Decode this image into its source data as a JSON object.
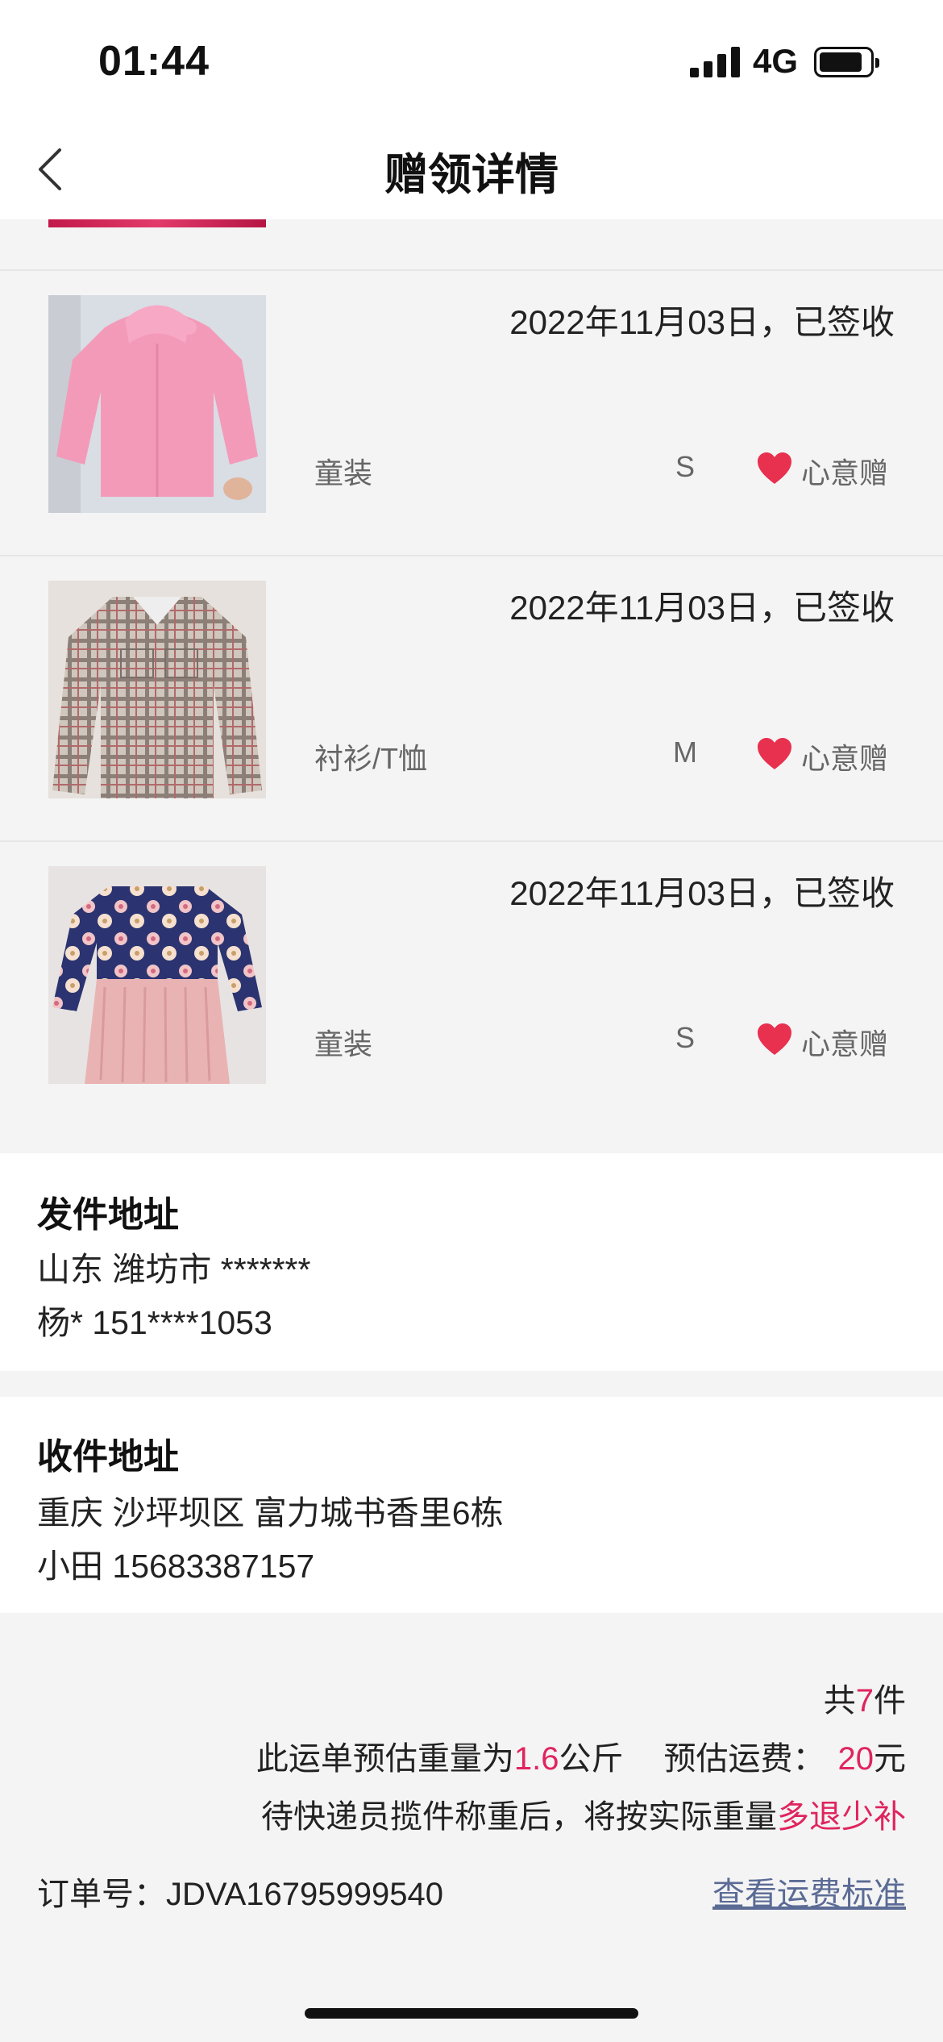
{
  "status_bar": {
    "time": "01:44",
    "network": "4G"
  },
  "nav": {
    "title": "赠领详情"
  },
  "items": [
    {
      "date_status": "2022年11月03日，已签收",
      "category": "童装",
      "size": "S",
      "gift_type": "心意赠",
      "photo": "pink knitted hooded sweater"
    },
    {
      "date_status": "2022年11月03日，已签收",
      "category": "衬衫/T恤",
      "size": "M",
      "gift_type": "心意赠",
      "photo": "plaid shirt dress"
    },
    {
      "date_status": "2022年11月03日，已签收",
      "category": "童装",
      "size": "S",
      "gift_type": "心意赠",
      "photo": "floral top with pink fringe skirt"
    }
  ],
  "sender": {
    "title": "发件地址",
    "address": "山东 潍坊市 *******",
    "contact": "杨* 151****1053"
  },
  "receiver": {
    "title": "收件地址",
    "address": "重庆 沙坪坝区 富力城书香里6栋",
    "contact": "小田 15683387157"
  },
  "summary": {
    "count_prefix": "共",
    "count": "7",
    "count_suffix": "件",
    "weight_prefix": "此运单预估重量为",
    "weight": "1.6",
    "weight_unit": "公斤",
    "fee_label": "预估运费：",
    "fee": "20",
    "fee_unit": "元",
    "note_prefix": "待快递员揽件称重后，将按实际重量",
    "note_highlight": "多退少补",
    "order_label": "订单号：",
    "order_number": "JDVA16795999540",
    "fee_standard_link": "查看运费标准"
  },
  "colors": {
    "accent_red": "#e0245e",
    "link": "#5b6b95",
    "heart": "#e8304f"
  },
  "icons": {
    "back": "chevron-left-icon",
    "heart": "heart-icon",
    "signal": "signal-icon",
    "battery": "battery-icon"
  }
}
